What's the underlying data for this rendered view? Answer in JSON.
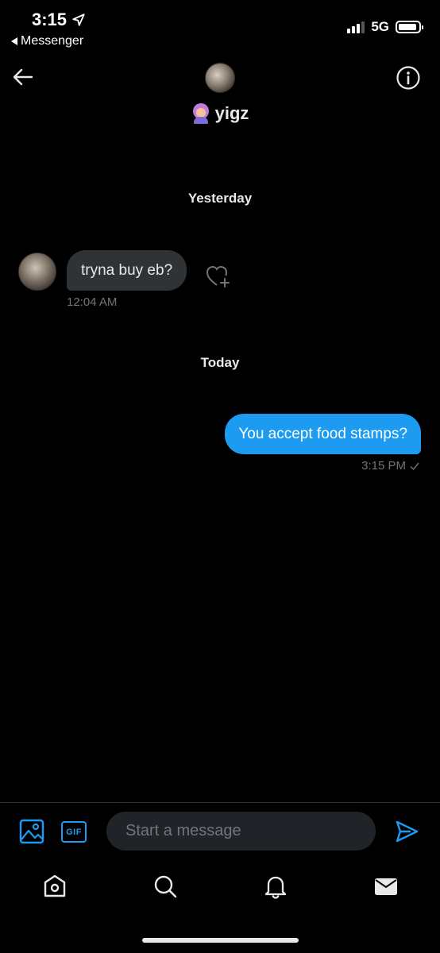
{
  "status_bar": {
    "time": "3:15",
    "back_app_label": "Messenger",
    "network": "5G",
    "signal_bars": 3,
    "battery_level": 0.9
  },
  "header": {
    "contact_name": "yigz",
    "name_emoji": "purple-hair-person-emoji",
    "back_icon": "arrow-left-icon",
    "info_icon": "info-circle-icon"
  },
  "conversation": {
    "days": [
      {
        "label": "Yesterday",
        "messages": [
          {
            "direction": "incoming",
            "text": "tryna buy eb?",
            "time": "12:04 AM",
            "reaction_icon": "heart-add-icon"
          }
        ]
      },
      {
        "label": "Today",
        "messages": [
          {
            "direction": "outgoing",
            "text": "You accept food stamps?",
            "time": "3:15 PM",
            "status_icon": "checkmark-icon"
          }
        ]
      }
    ]
  },
  "composer": {
    "placeholder": "Start a message",
    "gif_label": "GIF",
    "media_icon": "image-icon",
    "send_icon": "send-icon"
  },
  "tab_bar": {
    "tabs": [
      "home-icon",
      "search-icon",
      "bell-icon",
      "mail-icon"
    ]
  },
  "colors": {
    "background": "#000000",
    "accent": "#1d9bf0",
    "incoming_bubble": "#2f3336",
    "secondary_text": "#71767b",
    "input_background": "#202327"
  }
}
